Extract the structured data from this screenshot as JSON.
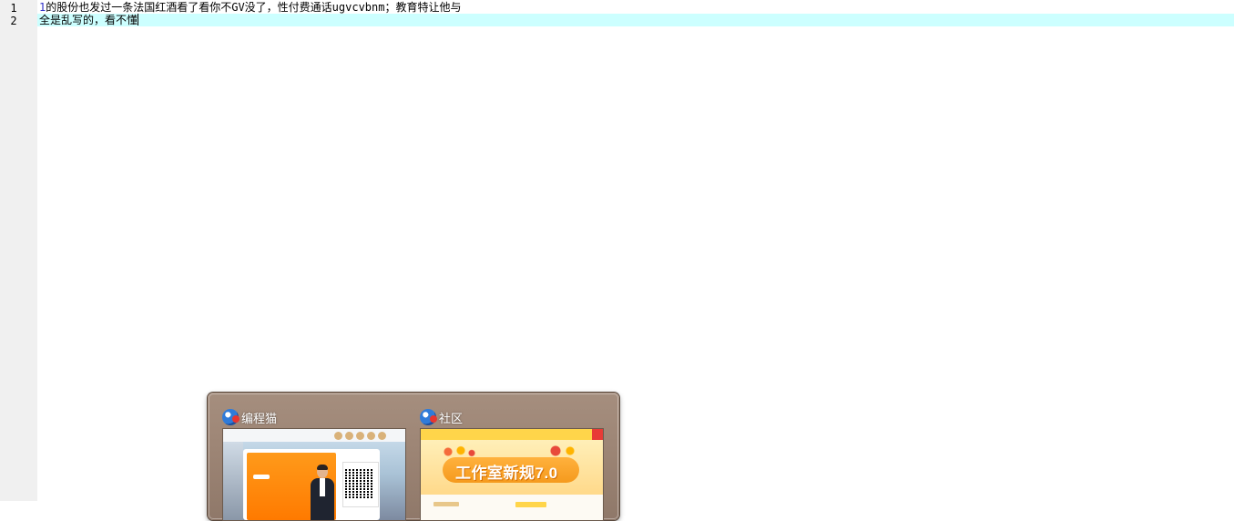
{
  "editor": {
    "lines": [
      {
        "number": "1",
        "digit": "1",
        "text": "的股份也发过一条法国红酒看了看你不GV没了，性付费通话ugvcvbnm；教育特让他与"
      },
      {
        "number": "2",
        "digit": "",
        "text": "全是乱写的，看不懂"
      }
    ],
    "colors": {
      "gutter": "#f0f0f0",
      "active_line": "#ccffff",
      "number_token": "#3030c8"
    }
  },
  "task_switcher": {
    "windows": [
      {
        "title": "编程猫",
        "icon": "codemao-app-icon"
      },
      {
        "title": "社区",
        "icon": "codemao-app-icon"
      }
    ],
    "thumbnails": {
      "community_banner": "工作室新规7.0"
    }
  }
}
